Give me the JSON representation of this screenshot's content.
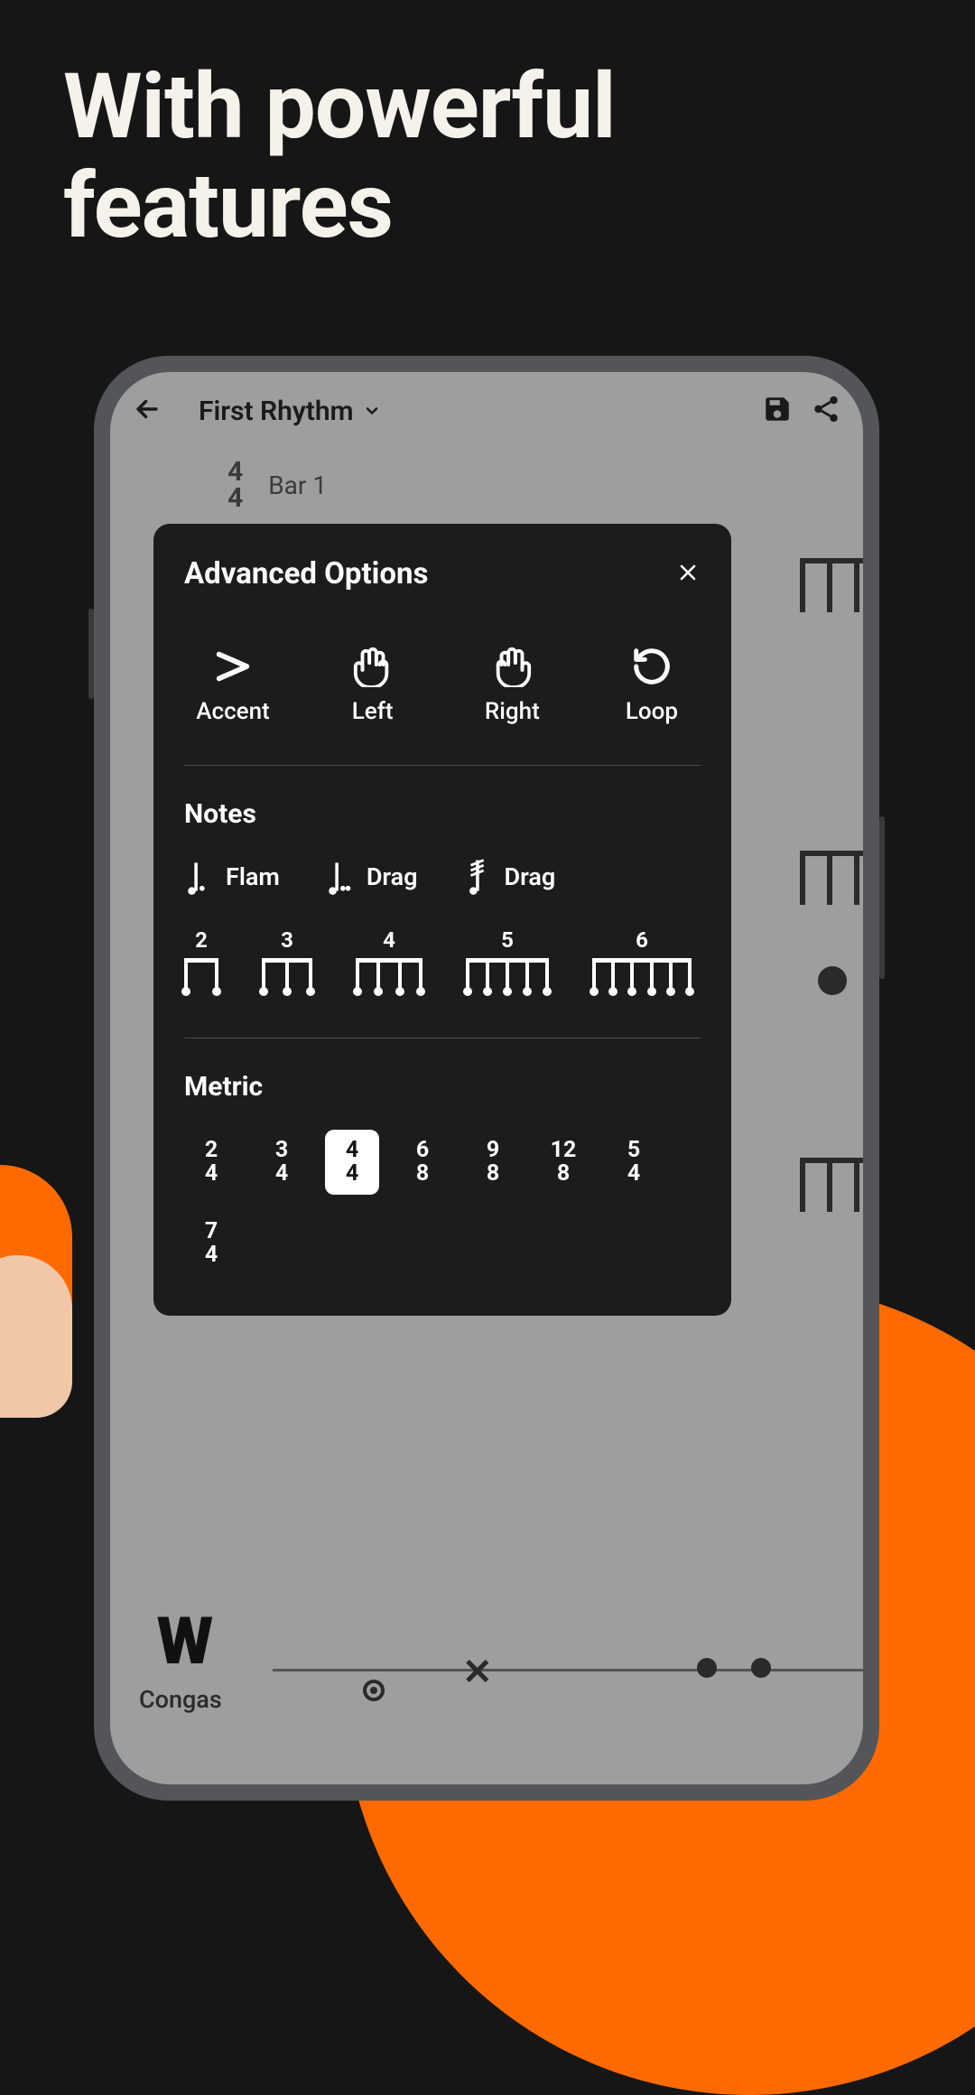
{
  "headline": "With powerful features",
  "app": {
    "project_title": "First Rhythm",
    "time_sig_top": "4",
    "time_sig_bottom": "4",
    "bar_label": "Bar 1",
    "instrument": "Congas"
  },
  "modal": {
    "title": "Advanced Options",
    "actions": [
      {
        "label": "Accent"
      },
      {
        "label": "Left"
      },
      {
        "label": "Right"
      },
      {
        "label": "Loop"
      }
    ],
    "notes_title": "Notes",
    "note_items": [
      {
        "label": "Flam"
      },
      {
        "label": "Drag"
      },
      {
        "label": "Drag"
      }
    ],
    "subdivisions": [
      "2",
      "3",
      "4",
      "5",
      "6"
    ],
    "metric_title": "Metric",
    "metrics": [
      {
        "top": "2",
        "bottom": "4",
        "selected": false
      },
      {
        "top": "3",
        "bottom": "4",
        "selected": false
      },
      {
        "top": "4",
        "bottom": "4",
        "selected": true
      },
      {
        "top": "6",
        "bottom": "8",
        "selected": false
      },
      {
        "top": "9",
        "bottom": "8",
        "selected": false
      },
      {
        "top": "12",
        "bottom": "8",
        "selected": false
      },
      {
        "top": "5",
        "bottom": "4",
        "selected": false
      },
      {
        "top": "7",
        "bottom": "4",
        "selected": false
      }
    ]
  }
}
